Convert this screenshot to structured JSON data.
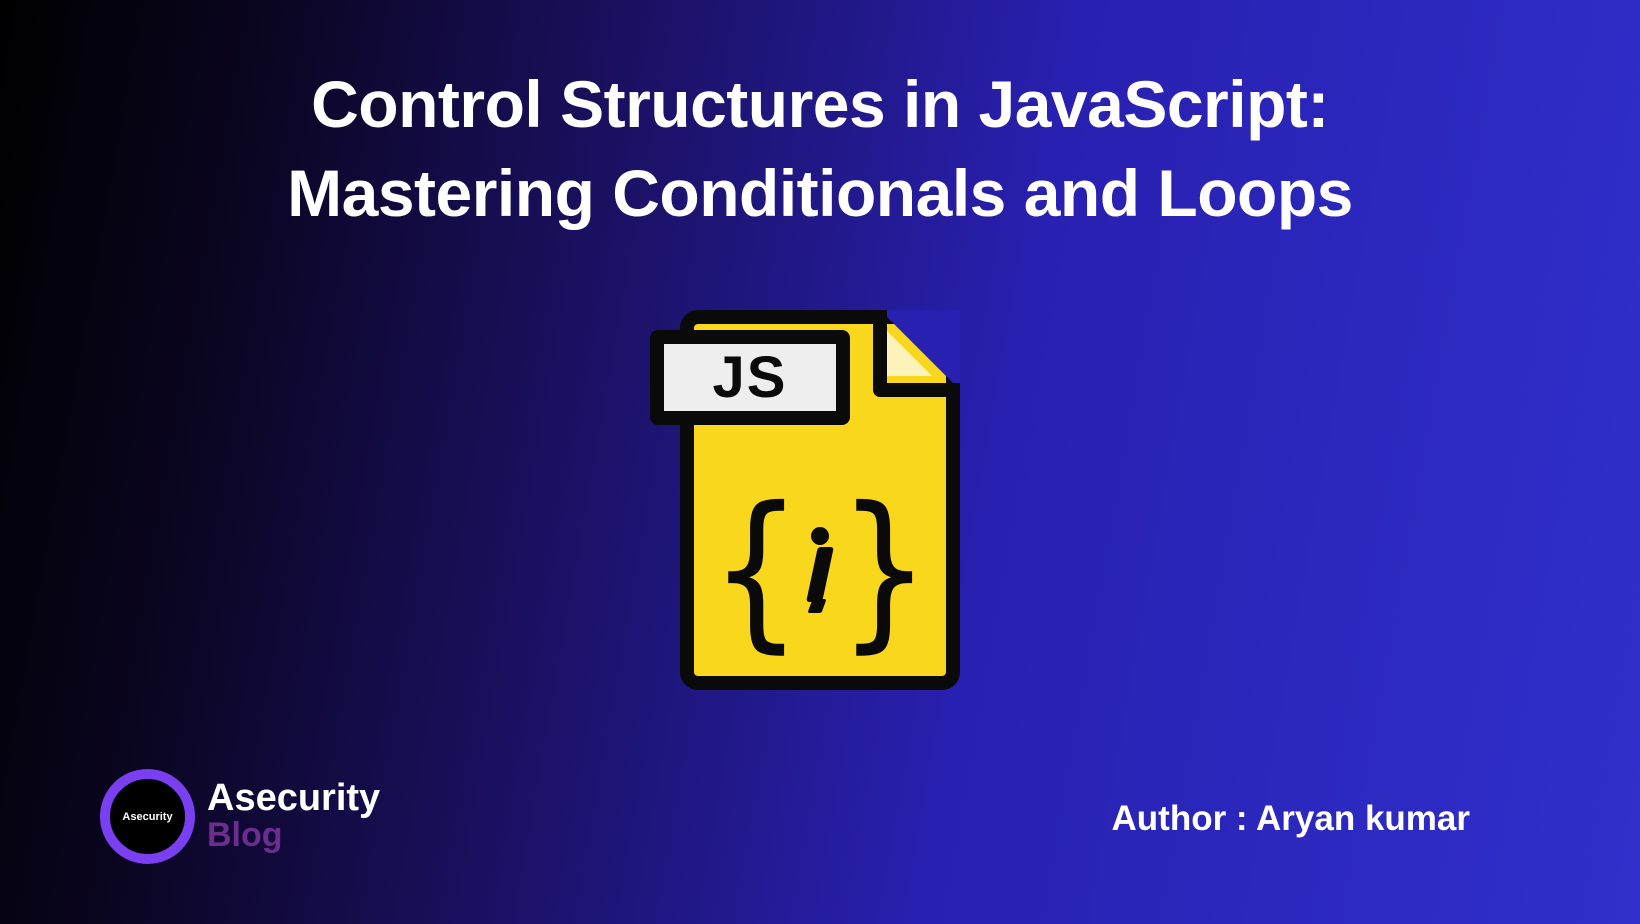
{
  "title": "Control Structures in JavaScript:\nMastering Conditionals and Loops",
  "icon": {
    "label": "JS"
  },
  "logo": {
    "inner_text": "Asecurity",
    "text_top": "Asecurity",
    "text_bottom": "Blog"
  },
  "author_label": "Author : Aryan kumar"
}
